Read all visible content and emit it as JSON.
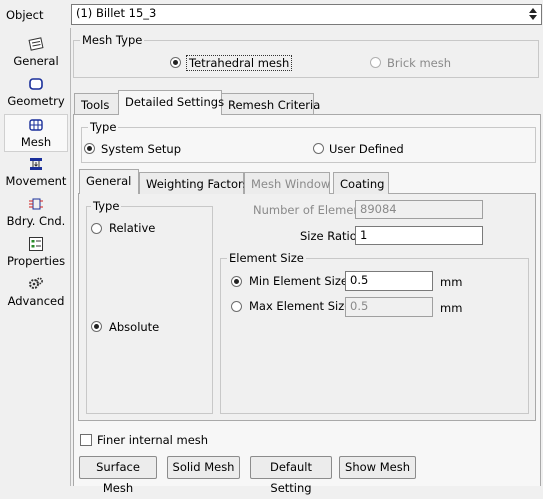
{
  "object": {
    "label": "Object",
    "value": "(1) Billet 15_3"
  },
  "nav": [
    {
      "label": "General",
      "icon": "general-icon"
    },
    {
      "label": "Geometry",
      "icon": "geometry-icon"
    },
    {
      "label": "Mesh",
      "icon": "mesh-icon"
    },
    {
      "label": "Movement",
      "icon": "movement-icon"
    },
    {
      "label": "Bdry. Cnd.",
      "icon": "boundary-condition-icon"
    },
    {
      "label": "Properties",
      "icon": "properties-icon"
    },
    {
      "label": "Advanced",
      "icon": "advanced-icon"
    }
  ],
  "mesh_type": {
    "caption": "Mesh Type",
    "tetra": "Tetrahedral mesh",
    "brick": "Brick mesh"
  },
  "main_tabs": [
    "Tools",
    "Detailed Settings",
    "Remesh Criteria"
  ],
  "type_group": {
    "caption": "Type",
    "system": "System Setup",
    "user": "User Defined"
  },
  "sub_tabs": [
    "General",
    "Weighting Factors",
    "Mesh Window",
    "Coating"
  ],
  "general": {
    "type_caption": "Type",
    "relative": "Relative",
    "absolute": "Absolute",
    "num_elements_label": "Number of Elements",
    "num_elements_value": "89084",
    "size_ratio_label": "Size Ratio",
    "size_ratio_value": "1",
    "element_size_caption": "Element Size",
    "min_label": "Min Element Size",
    "min_value": "0.5",
    "max_label": "Max Element Size",
    "max_value": "0.5",
    "unit": "mm"
  },
  "finer_internal": "Finer internal mesh",
  "buttons": [
    "Surface Mesh",
    "Solid Mesh",
    "Default Setting",
    "Show Mesh"
  ],
  "colors": {
    "background": "#f0f0f0",
    "field_border": "#7a7a7a"
  }
}
